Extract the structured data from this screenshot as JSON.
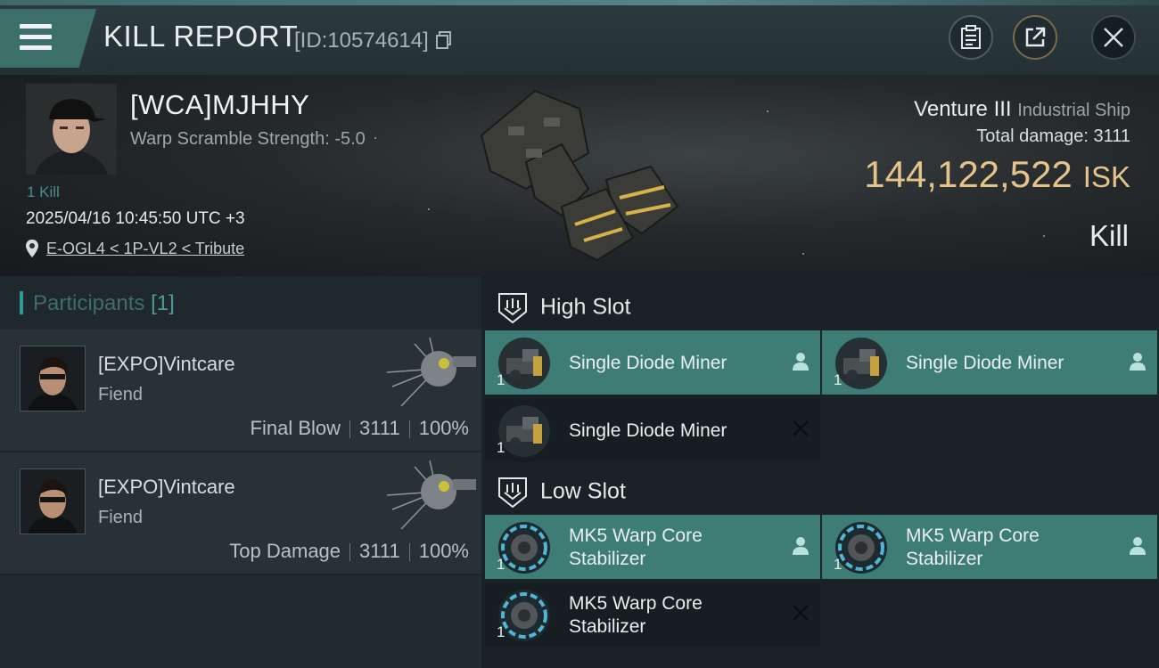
{
  "header": {
    "title": "KILL REPORT",
    "report_id": "[ID:10574614]"
  },
  "victim": {
    "name": "[WCA]MJHHY",
    "warp_scramble": "Warp Scramble Strength: -5.0",
    "kills": "1 Kill",
    "timestamp": "2025/04/16 10:45:50 UTC +3",
    "location": "E-OGL4 < 1P-VL2 < Tribute",
    "ship_name": "Venture III",
    "ship_class": "Industrial Ship",
    "total_damage_label": "Total damage:",
    "total_damage": "3111",
    "isk_value": "144,122,522",
    "isk_unit": "ISK",
    "result": "Kill"
  },
  "participants": {
    "title": "Participants",
    "count": "[1]",
    "items": [
      {
        "name": "[EXPO]Vintcare",
        "ship": "Fiend",
        "role": "Final Blow",
        "damage": "3111",
        "percent": "100%"
      },
      {
        "name": "[EXPO]Vintcare",
        "ship": "Fiend",
        "role": "Top Damage",
        "damage": "3111",
        "percent": "100%"
      }
    ]
  },
  "fitting": {
    "high_slot": {
      "title": "High Slot",
      "modules": [
        {
          "name": "Single Diode Miner",
          "qty": "1",
          "status": "fitted"
        },
        {
          "name": "Single Diode Miner",
          "qty": "1",
          "status": "fitted"
        },
        {
          "name": "Single Diode Miner",
          "qty": "1",
          "status": "destroyed"
        }
      ]
    },
    "low_slot": {
      "title": "Low Slot",
      "modules": [
        {
          "name_line1": "MK5 Warp Core",
          "name_line2": "Stabilizer",
          "qty": "1",
          "status": "fitted"
        },
        {
          "name_line1": "MK5 Warp Core",
          "name_line2": "Stabilizer",
          "qty": "1",
          "status": "fitted"
        },
        {
          "name_line1": "MK5 Warp Core",
          "name_line2": "Stabilizer",
          "qty": "1",
          "status": "destroyed"
        }
      ]
    }
  },
  "colors": {
    "accent": "#3e7d76",
    "isk": "#e5c48a",
    "background": "#1b2328"
  },
  "icons": [
    "menu-icon",
    "clipboard-icon",
    "share-icon",
    "close-icon",
    "location-pin-icon",
    "slot-shield-icon",
    "pilot-icon",
    "destroyed-x-icon"
  ]
}
